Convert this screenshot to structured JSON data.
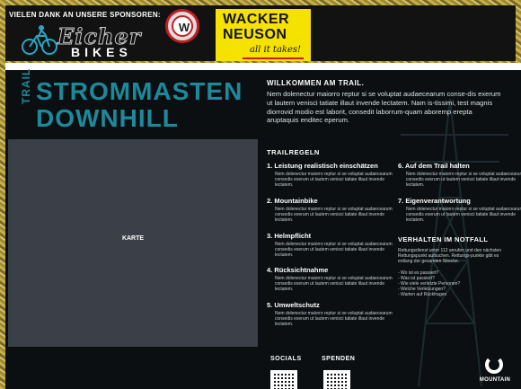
{
  "sponsors": {
    "heading": "VIELEN DANK AN UNSERE SPONSOREN:",
    "eicher_script": "Eicher",
    "eicher_sub": "BIKES",
    "wacker_icon": "W",
    "wacker_line1": "WACKER",
    "wacker_line2": "NEUSON",
    "wacker_tag": "all it takes!"
  },
  "title": {
    "vertical": "TRAIL",
    "line1": "STROMMASTEN",
    "line2": "DOWNHILL"
  },
  "intro": {
    "heading": "WILLKOMMEN AM TRAIL.",
    "text": "Nem dolenectur maiorro reptur si se voluptat audaecearum conse-dis exerum ut lautem venisci tatiate illaut invende lectatem. Nam is-tissimi, test magnis diorrovid modio est laborit, consedit laborrum-quam aboremp erepta aruptaquis enditec eperum."
  },
  "map": {
    "label": "KARTE"
  },
  "rules": {
    "heading": "TRAILREGELN",
    "items": [
      {
        "title": "1.  Leistung realistisch einschätzen",
        "text": "Nem dolenectur maiorro reptur si se voluptat audaecearum consedis exerum ut lautem venisci tatiate illaut invende lectatem."
      },
      {
        "title": "2. Mountainbike",
        "text": "Nem dolenectur maiorro reptur si se voluptat audaecearum consedis exerum ut lautem venisci tatiate illaut invende lectatem."
      },
      {
        "title": "3. Helmpflicht",
        "text": "Nem dolenectur maiorro reptur si se voluptat audaecearum consedis exerum ut lautem venisci tatiate illaut invende lectatem."
      },
      {
        "title": "4. Rücksichtnahme",
        "text": "Nem dolenectur maiorro reptur si se voluptat audaecearum consedis exerum ut lautem venisci tatiate illaut invende lectatem."
      },
      {
        "title": "5. Umweltschutz",
        "text": "Nem dolenectur maiorro reptur si se voluptat audaecearum consedis exerum ut lautem venisci tatiate illaut invende lectatem."
      },
      {
        "title": "6.  Auf dem Trail halten",
        "text": "Nem dolenectur maiorro reptur si se voluptat audaecearum consedis exerum ut lautem venisci tatiate illaut invende lectatem."
      },
      {
        "title": "7. Eigenverantwortung",
        "text": "Nem dolenectur maiorro reptur si se voluptat audaecearum consedis exerum ut lautem venisci tatiate illaut invende lectatem."
      }
    ]
  },
  "emergency": {
    "heading": "VERHALTEN IM NOTFALL",
    "text": "Rettungsdienst unter 112 anrufen und den nächsten Rettungspunkt aufsuchen. Rettungs-punkte gibt es entlang der gesamten Strecke.",
    "list": [
      "- Wo ist es passiert?",
      "- Was ist passiert?",
      "- Wie viele verletzte Personen?",
      "- Welche Verletzungen?",
      "- Warten auf Rückfragen"
    ]
  },
  "footer": {
    "socials": "SOCIALS",
    "spenden": "SPENDEN",
    "brand": "MOUNTAIN"
  },
  "colors": {
    "accent": "#1c8a9a",
    "board_bg": "#0c0f11",
    "map_bg": "#3b4048",
    "wacker_yellow": "#f6e200",
    "wacker_red": "#c51d24"
  }
}
